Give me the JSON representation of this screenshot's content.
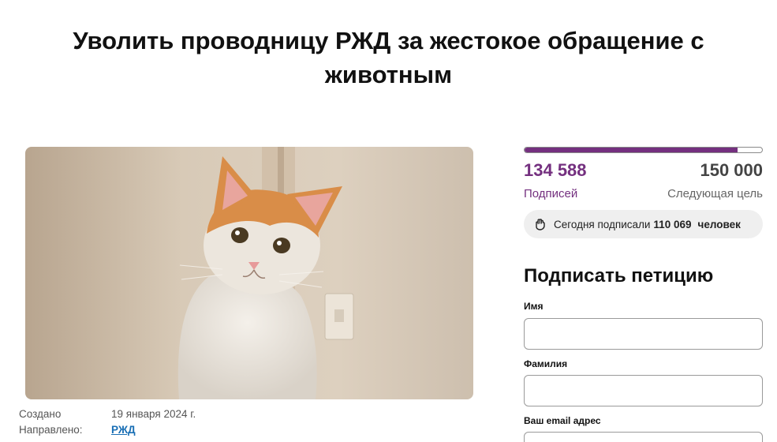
{
  "petition": {
    "title": "Уволить проводницу РЖД за жестокое обращение с животным"
  },
  "meta": {
    "created_label": "Создано",
    "created_value": "19 января 2024 г.",
    "sent_label": "Направлено:",
    "sent_value": "РЖД"
  },
  "stats": {
    "signed_count": "134 588",
    "signed_label": "Подписей",
    "goal_count": "150 000",
    "goal_label": "Следующая цель",
    "progress_fraction": 0.897,
    "today_prefix": "Сегодня подписали",
    "today_count": "110 069",
    "today_suffix": "человек",
    "today_icon": "fist-icon"
  },
  "form": {
    "title": "Подписать петицию",
    "first_name_label": "Имя",
    "last_name_label": "Фамилия",
    "email_label": "Ваш email адрес"
  },
  "colors": {
    "accent": "#74307f",
    "link": "#1a6fb5"
  }
}
